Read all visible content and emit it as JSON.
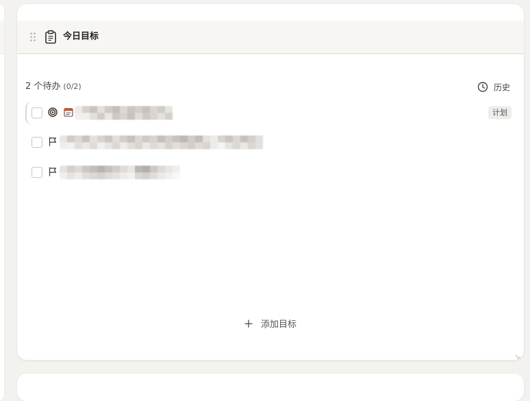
{
  "widget": {
    "title": "今日目标",
    "title_icon": "clipboard-icon",
    "drag_icon": "drag-handle-icon"
  },
  "summary": {
    "count_label": "2 个待办",
    "progress": "(0/2)"
  },
  "history": {
    "icon": "clock-icon",
    "label": "历史"
  },
  "tasks": [
    {
      "checked": false,
      "icons": [
        "target-icon",
        "calendar-icon"
      ],
      "text_redacted": true,
      "badge": "计划"
    },
    {
      "checked": false,
      "icons": [
        "flag-icon"
      ],
      "text_redacted": true
    },
    {
      "checked": false,
      "icons": [
        "flag-icon"
      ],
      "text_redacted": true
    }
  ],
  "add_goal": {
    "icon": "plus-icon",
    "label": "添加目标"
  },
  "colors": {
    "header_bg": "#f7f6f3",
    "page_bg": "#f3f2ef",
    "card_bg": "#ffffff",
    "calendar_accent": "#d9542f",
    "target_accent": "#3a2a20"
  }
}
